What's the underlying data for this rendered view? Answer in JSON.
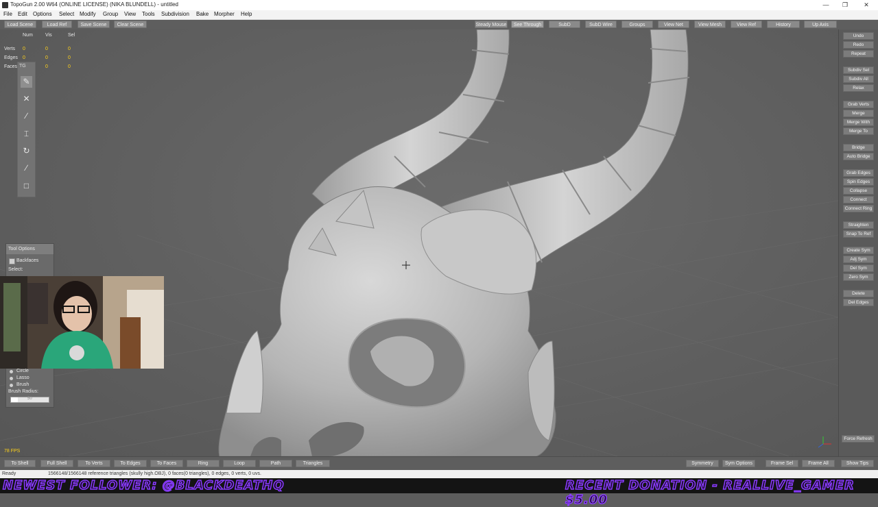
{
  "window": {
    "title": "TopoGun 2.00 W64  (ONLINE LICENSE) (NIKA BLUNDELL) - untitled",
    "controls": [
      "—",
      "❐",
      "✕"
    ]
  },
  "menu": [
    "File",
    "Edit",
    "Options",
    "Select",
    "Modify",
    "Group",
    "View",
    "Tools",
    "Subdivision",
    "Bake",
    "Morpher",
    "Help"
  ],
  "toolbar": {
    "left": [
      "Load Scene",
      "Load Ref",
      "Save Scene",
      "Clear Scene"
    ],
    "right": [
      "Steady Mouse",
      "See Through",
      "SubD",
      "SubD Wire",
      "Groups",
      "View Net",
      "View Mesh",
      "View Ref",
      "History",
      "Up Axis"
    ]
  },
  "stats": {
    "headers": [
      "Num",
      "Vis",
      "Sel"
    ],
    "rows": [
      {
        "label": "Verts",
        "num": "0",
        "vis": "0",
        "sel": "0"
      },
      {
        "label": "Edges",
        "num": "0",
        "vis": "0",
        "sel": "0"
      },
      {
        "label": "Faces",
        "num": "0",
        "vis": "0",
        "sel": "0"
      }
    ]
  },
  "tool_strip_label": "TG",
  "tool_options": {
    "header": "Tool Options",
    "backfaces_label": "Backfaces",
    "select_label": "Select:",
    "modes": [
      "Circle",
      "Lasso",
      "Brush"
    ],
    "brush_radius_label": "Brush Radius:",
    "brush_radius_value": "50"
  },
  "right_panel": {
    "groups": [
      [
        "Undo",
        "Redo",
        "Repeat"
      ],
      [
        "Subdiv Sel",
        "Subdiv All",
        "Relax"
      ],
      [
        "Grab Verts",
        "Merge",
        "Merge With",
        "Merge To"
      ],
      [
        "Bridge",
        "Auto Bridge"
      ],
      [
        "Grab Edges",
        "Spin Edges",
        "Collapse",
        "Connect",
        "Connect Ring"
      ],
      [
        "Straighten",
        "Snap To Ref"
      ],
      [
        "Create Sym",
        "Adj Sym",
        "Del Sym",
        "Zero Sym"
      ],
      [
        "Delete",
        "Del Edges"
      ]
    ],
    "force_refresh": "Force Refresh"
  },
  "fps": "78 FPS",
  "bottom_bar": {
    "left": [
      "To Shell",
      "Full Shell",
      "To Verts",
      "To Edges",
      "To Faces",
      "Ring",
      "Loop",
      "Path",
      "Triangles"
    ],
    "right": [
      "Symmetry",
      "Sym Options",
      "Frame Sel",
      "Frame All",
      "Show Tips"
    ]
  },
  "status": {
    "ready": "Ready",
    "info": "1566148/1566148 reference triangles (skully high.OBJ), 0 faces(0 triangles), 0 edges, 0 verts, 0 uvs."
  },
  "overlay": {
    "follower": "NEWEST FOLLOWER: @BLACKDEATHQ",
    "donation": "RECENT DONATION - REALLIVE_GAMER $5.00"
  },
  "colors": {
    "accent_overlay": "#8a3cff",
    "stat_value": "#ffd21a",
    "viewport_bg": "#5f5f5f"
  }
}
